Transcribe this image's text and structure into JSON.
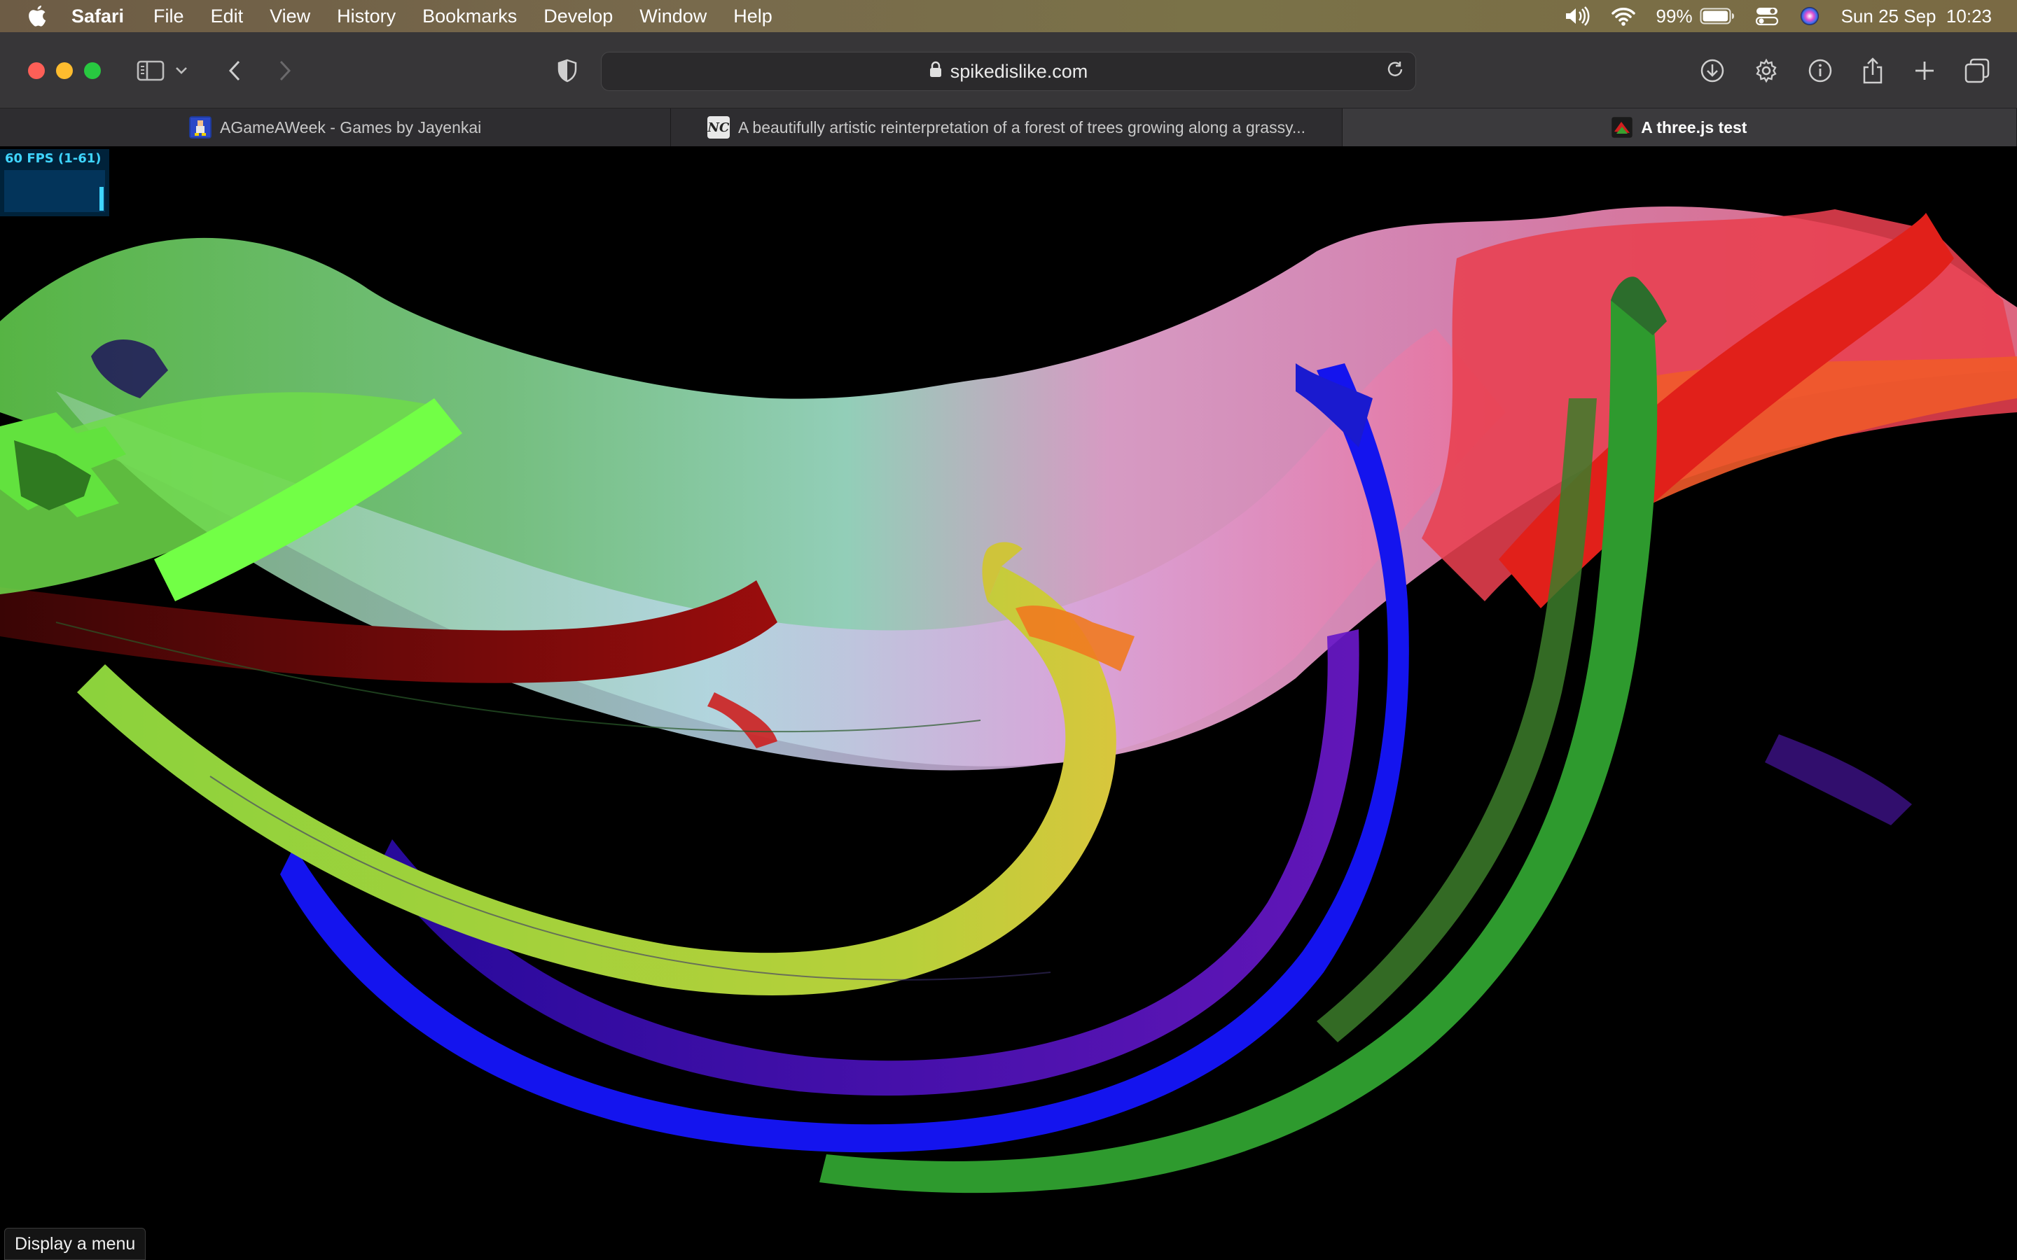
{
  "menubar": {
    "app_name": "Safari",
    "items": [
      "File",
      "Edit",
      "View",
      "History",
      "Bookmarks",
      "Develop",
      "Window",
      "Help"
    ],
    "battery_percent": "99%",
    "battery_level": 0.99,
    "clock": "Sun 25 Sep  10:23",
    "icons": [
      "apple-icon",
      "volume-icon",
      "wifi-icon",
      "battery-icon",
      "control-center-icon",
      "siri-icon"
    ]
  },
  "toolbar": {
    "url": "spikedislike.com",
    "icons": [
      "sidebar-icon",
      "chevron-down-icon",
      "back-icon",
      "forward-icon",
      "privacy-shield-icon",
      "lock-icon",
      "reload-icon",
      "download-icon",
      "gear-icon",
      "info-icon",
      "share-icon",
      "plus-icon",
      "tab-overview-icon"
    ]
  },
  "tabs": [
    {
      "title": "AGameAWeek - Games by Jayenkai",
      "active": false
    },
    {
      "title": "A beautifully artistic reinterpretation of a forest of trees growing along a grassy...",
      "active": false,
      "favicon_text": "NC"
    },
    {
      "title": "A three.js test",
      "active": true
    }
  ],
  "content": {
    "fps_label": "60 FPS (1-61)",
    "tooltip": "Display a menu"
  },
  "colors": {
    "menubar": "#786a4c",
    "toolbar": "#373638",
    "tab_active": "#3b3a3d",
    "fps_text": "#3fd5ff"
  }
}
